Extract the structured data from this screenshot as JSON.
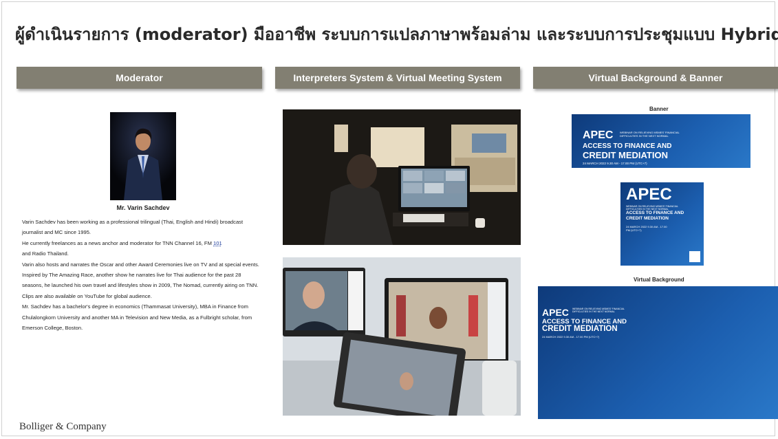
{
  "title": "ผู้ดำเนินรายการ (moderator) มืออาชีพ ระบบการแปลภาษาพร้อมล่าม และระบบการประชุมแบบ Hybrid",
  "columns": {
    "moderator": "Moderator",
    "interpreters": "Interpreters System & Virtual Meeting System",
    "virtual": "Virtual Background & Banner"
  },
  "moderator": {
    "name": "Mr. Varin Sachdev",
    "bio": [
      "Varin Sachdev has been working as a professional trilingual (Thai, English and Hindi) broadcast journalist and MC since 1995.",
      "He currently freelances as a news anchor and moderator for TNN Channel 16, FM",
      "101",
      "and Radio Thailand.",
      "Varin also hosts and narrates the Oscar and other Award Ceremonies live on TV and at special events. Inspired by The Amazing Race, another show he narrates live for Thai audience for the past 28 seasons, he launched his own travel and lifestyles show in 2009, The Nomad, currently airing on TNN.",
      "Clips are also available on YouTube for global audience.",
      "Mr. Sachdev has a bachelor's degree in economics (Thammasat University), MBA in Finance from Chulalongkorn University and another MA in Television and New Media, as a Fulbright scholar, from Emerson College, Boston."
    ]
  },
  "banner_label": "Banner",
  "virtual_bg_label": "Virtual Background",
  "banner": {
    "apec": "APEC",
    "subtitle": "WEBINAR ON RELIEVING MSMES' FINANCIAL DIFFICULTIES IN THE NEXT NORMAL",
    "line1": "ACCESS TO FINANCE AND",
    "line2": "CREDIT MEDIATION",
    "date": "24 MARCH 2022 9.30 AM - 17.00 PM (UTC+7)"
  },
  "footer": "Bolliger & Company",
  "colors": {
    "header_bg": "#827f72",
    "banner_blue": "#1c5fb0"
  }
}
